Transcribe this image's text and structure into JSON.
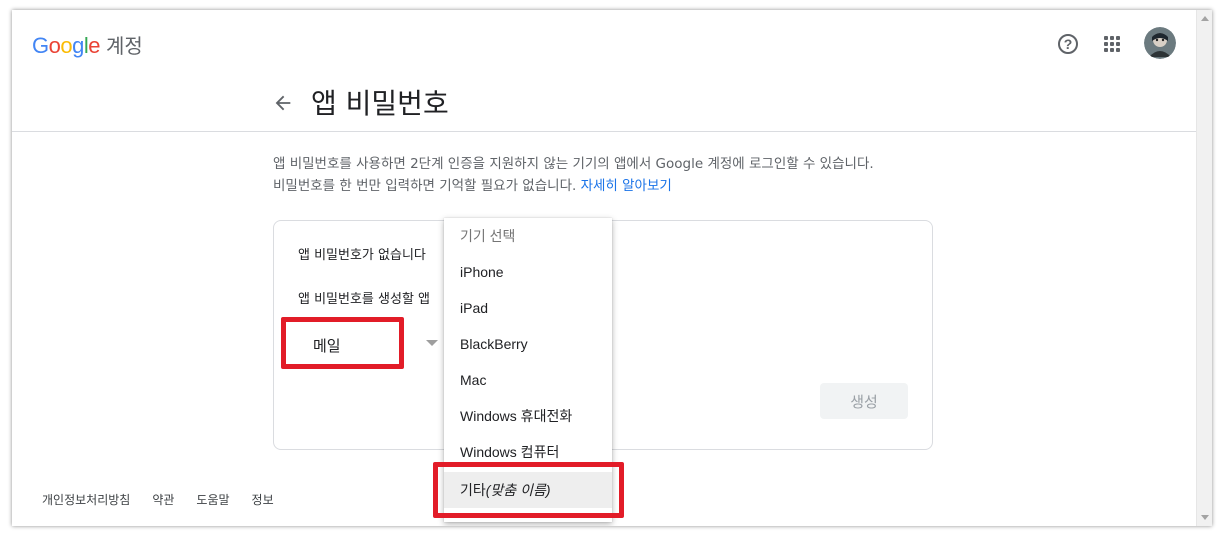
{
  "header": {
    "logo_word": "Google",
    "product": "계정",
    "logo_colors": [
      "#4285F4",
      "#EA4335",
      "#FBBC05",
      "#4285F4",
      "#34A853",
      "#EA4335"
    ],
    "help_icon": "help-circle-icon",
    "apps_icon": "apps-grid-icon",
    "avatar": "account-avatar"
  },
  "page": {
    "back_icon": "arrow-left-icon",
    "title": "앱 비밀번호",
    "description_line1": "앱 비밀번호를 사용하면 2단계 인증을 지원하지 않는 기기의 앱에서 Google 계정에 로그인할 수 있습니다.",
    "description_line2": "비밀번호를 한 번만 입력하면 기억할 필요가 없습니다.",
    "learn_more": "자세히 알아보기"
  },
  "card": {
    "no_passwords_text": "앱 비밀번호가 없습니다",
    "select_prompt": "앱 비밀번호를 생성할 앱",
    "app_select_value": "메일",
    "generate_button": "생성"
  },
  "device_dropdown": {
    "placeholder": "기기 선택",
    "options": [
      "iPhone",
      "iPad",
      "BlackBerry",
      "Mac",
      "Windows 휴대전화",
      "Windows 컴퓨터"
    ],
    "other_prefix": "기타",
    "other_suffix": "(맞춤 이름)"
  },
  "footer": {
    "links": [
      "개인정보처리방침",
      "약관",
      "도움말",
      "정보"
    ]
  },
  "colors": {
    "accent": "#1a73e8",
    "highlight_border": "#e21c28",
    "divider": "#dadce0"
  }
}
